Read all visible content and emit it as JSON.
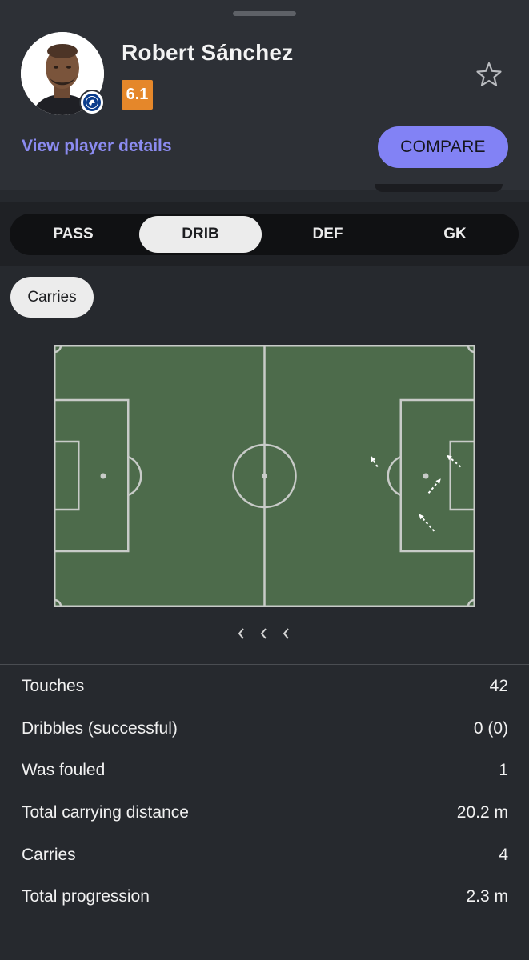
{
  "player": {
    "name": "Robert Sánchez",
    "rating": "6.1",
    "rating_color": "#e5872a",
    "avatar_icon": "player-photo",
    "club_icon": "club-crest-icon"
  },
  "actions": {
    "view_details_label": "View player details",
    "compare_label": "COMPARE",
    "favorite_icon": "star-icon"
  },
  "tabs": [
    {
      "label": "PASS",
      "active": false
    },
    {
      "label": "DRIB",
      "active": true
    },
    {
      "label": "DEF",
      "active": false
    },
    {
      "label": "GK",
      "active": false
    }
  ],
  "filter": {
    "chip_label": "Carries"
  },
  "pitch": {
    "color": "#4d6b4b",
    "line_color": "#c8cbc8",
    "carry_color": "#ffffff",
    "carries": [
      {
        "from": [
          0.768,
          0.465
        ],
        "to": [
          0.752,
          0.425
        ]
      },
      {
        "from": [
          0.965,
          0.465
        ],
        "to": [
          0.932,
          0.42
        ]
      },
      {
        "from": [
          0.889,
          0.565
        ],
        "to": [
          0.918,
          0.51
        ]
      },
      {
        "from": [
          0.902,
          0.71
        ],
        "to": [
          0.866,
          0.645
        ]
      }
    ]
  },
  "pager_icons": [
    "chevron-left-icon",
    "chevron-left-icon",
    "chevron-left-icon"
  ],
  "stats": [
    {
      "label": "Touches",
      "value": "42"
    },
    {
      "label": "Dribbles (successful)",
      "value": "0 (0)"
    },
    {
      "label": "Was fouled",
      "value": "1"
    },
    {
      "label": "Total carrying distance",
      "value": "20.2 m"
    },
    {
      "label": "Carries",
      "value": "4"
    },
    {
      "label": "Total progression",
      "value": "2.3 m"
    }
  ],
  "colors": {
    "accent": "#8282f5",
    "background": "#26292e",
    "sheet": "#2d3036"
  }
}
